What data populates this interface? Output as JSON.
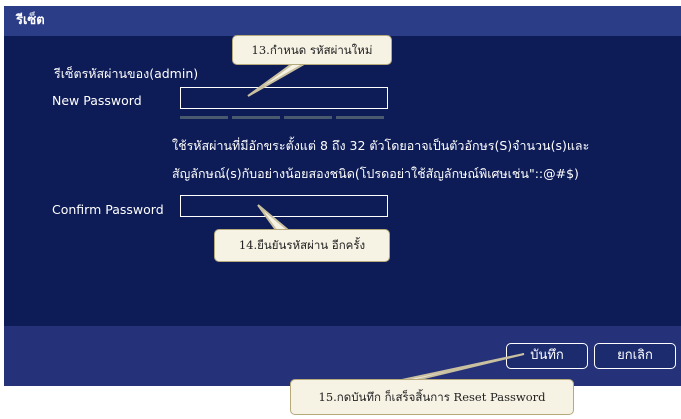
{
  "dialog": {
    "title": "รีเซ็ต",
    "section_label": "รีเซ็ตรหัสผ่านของ(admin)",
    "new_password_label": "New Password",
    "new_password_value": "",
    "confirm_password_label": "Confirm Password",
    "confirm_password_value": "",
    "hint_line1": "ใช้รหัสผ่านที่มีอักขระตั้งแต่ 8 ถึง 32 ตัวโดยอาจเป็นตัวอักษร(S)จำนวน(s)และ",
    "hint_line2": "สัญลักษณ์(s)กับอย่างน้อยสองชนิด(โปรดอย่าใช้สัญลักษณ์พิเศษเช่น\"::@#$)",
    "password_strength_segments": 4,
    "save_label": "บันทึก",
    "cancel_label": "ยกเลิก"
  },
  "callouts": {
    "step13": "13.กำหนด รหัสผ่านใหม่",
    "step14": "14.ยืนยันรหัสผ่าน อีกครั้ง",
    "step15": "15.กดบันทึก ก็เสร็จสิ้นการ Reset Password"
  },
  "colors": {
    "dialog_background": "#0d1b56",
    "title_bar": "#2b3d87",
    "footer": "#25327a",
    "callout_background": "#f6f2e4"
  }
}
